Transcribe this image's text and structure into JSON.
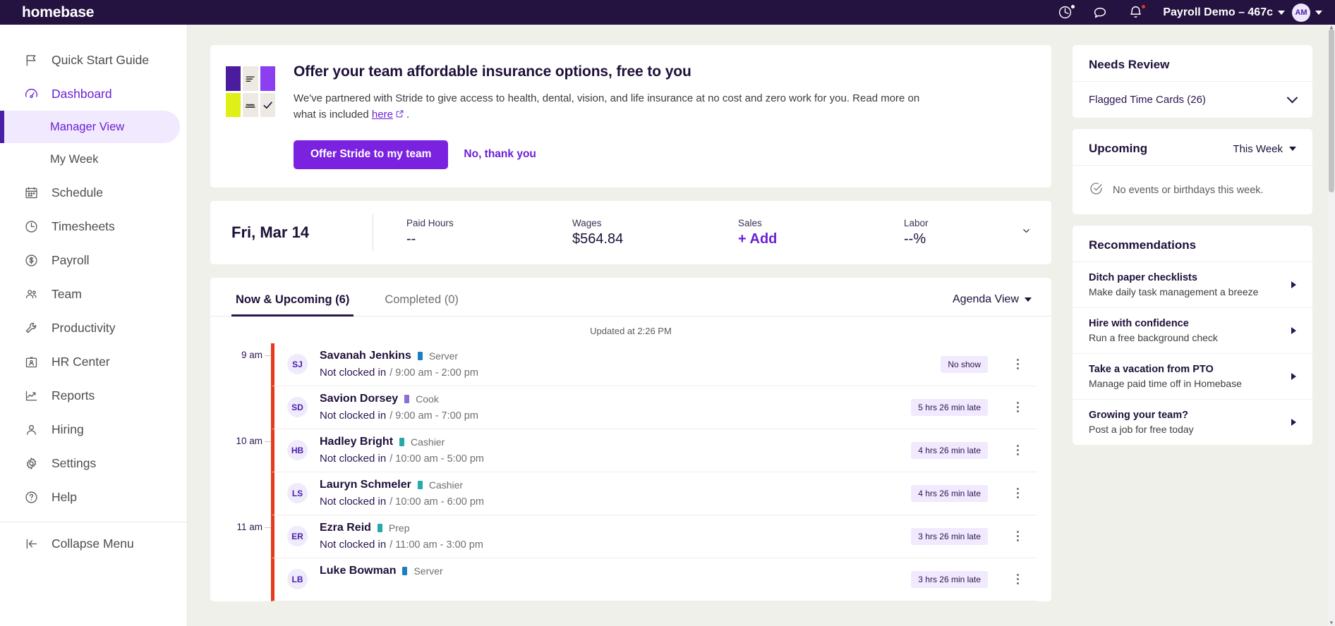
{
  "topbar": {
    "brand": "homebase",
    "account_label": "Payroll Demo – 467c",
    "avatar_initials": "AM",
    "icons": [
      {
        "name": "time-clock-icon",
        "badge": "white"
      },
      {
        "name": "chat-bubble-icon",
        "badge": "none"
      },
      {
        "name": "bell-icon",
        "badge": "red"
      }
    ]
  },
  "sidebar": {
    "items": [
      {
        "label": "Quick Start Guide",
        "icon": "flag-icon",
        "state": "default"
      },
      {
        "label": "Dashboard",
        "icon": "speedometer-icon",
        "state": "active"
      },
      {
        "label": "Schedule",
        "icon": "calendar-icon",
        "state": "default"
      },
      {
        "label": "Timesheets",
        "icon": "clock-icon",
        "state": "default"
      },
      {
        "label": "Payroll",
        "icon": "dollar-circle-icon",
        "state": "default"
      },
      {
        "label": "Team",
        "icon": "people-icon",
        "state": "default"
      },
      {
        "label": "Productivity",
        "icon": "wrench-icon",
        "state": "default"
      },
      {
        "label": "HR Center",
        "icon": "id-badge-icon",
        "state": "default"
      },
      {
        "label": "Reports",
        "icon": "chart-line-icon",
        "state": "default"
      },
      {
        "label": "Hiring",
        "icon": "person-icon",
        "state": "default"
      },
      {
        "label": "Settings",
        "icon": "gear-icon",
        "state": "default"
      },
      {
        "label": "Help",
        "icon": "question-circle-icon",
        "state": "default"
      }
    ],
    "sub_items": [
      {
        "label": "Manager View",
        "selected": true
      },
      {
        "label": "My Week",
        "selected": false
      }
    ],
    "collapse_label": "Collapse Menu"
  },
  "promo": {
    "title": "Offer your team affordable insurance options, free to you",
    "body_before": "We've partnered with Stride to give access to health, dental, vision, and life insurance at no cost and zero work for you. Read more on what is included ",
    "link_text": "here",
    "body_after": ".",
    "primary_button": "Offer Stride to my team",
    "secondary_button": "No, thank you"
  },
  "stats": {
    "date": "Fri, Mar 14",
    "items": [
      {
        "label": "Paid Hours",
        "value": "--",
        "accent": false
      },
      {
        "label": "Wages",
        "value": "$564.84",
        "accent": false
      },
      {
        "label": "Sales",
        "value": "+ Add",
        "accent": true
      },
      {
        "label": "Labor",
        "value": "--%",
        "accent": false
      }
    ]
  },
  "shifts": {
    "tabs": [
      {
        "label": "Now & Upcoming (6)",
        "active": true
      },
      {
        "label": "Completed (0)",
        "active": false
      }
    ],
    "view_selector": "Agenda View",
    "updated": "Updated at 2:26 PM",
    "rows": [
      {
        "time_label": "9 am",
        "initials": "SJ",
        "name": "Savanah Jenkins",
        "role": "Server",
        "role_color": "#1b7fc4",
        "status": "Not clocked in",
        "schedule": "/ 9:00 am - 2:00 pm",
        "badge": "No show"
      },
      {
        "time_label": "",
        "initials": "SD",
        "name": "Savion Dorsey",
        "role": "Cook",
        "role_color": "#8b6ed0",
        "status": "Not clocked in",
        "schedule": "/ 9:00 am - 7:00 pm",
        "badge": "5 hrs 26 min late"
      },
      {
        "time_label": "10 am",
        "initials": "HB",
        "name": "Hadley Bright",
        "role": "Cashier",
        "role_color": "#25a9a9",
        "status": "Not clocked in",
        "schedule": "/ 10:00 am - 5:00 pm",
        "badge": "4 hrs 26 min late"
      },
      {
        "time_label": "",
        "initials": "LS",
        "name": "Lauryn Schmeler",
        "role": "Cashier",
        "role_color": "#25a9a9",
        "status": "Not clocked in",
        "schedule": "/ 10:00 am - 6:00 pm",
        "badge": "4 hrs 26 min late"
      },
      {
        "time_label": "11 am",
        "initials": "ER",
        "name": "Ezra Reid",
        "role": "Prep",
        "role_color": "#25a9a9",
        "status": "Not clocked in",
        "schedule": "/ 11:00 am - 3:00 pm",
        "badge": "3 hrs 26 min late"
      },
      {
        "time_label": "",
        "initials": "LB",
        "name": "Luke Bowman",
        "role": "Server",
        "role_color": "#1b7fc4",
        "status": "",
        "schedule": "",
        "badge": "3 hrs 26 min late"
      }
    ]
  },
  "rail": {
    "needs_review": {
      "title": "Needs Review",
      "rows": [
        {
          "label": "Flagged Time Cards (26)"
        }
      ]
    },
    "upcoming": {
      "title": "Upcoming",
      "range": "This Week",
      "empty_text": "No events or birthdays this week."
    },
    "recommendations": {
      "title": "Recommendations",
      "items": [
        {
          "title": "Ditch paper checklists",
          "subtitle": "Make daily task management a breeze"
        },
        {
          "title": "Hire with confidence",
          "subtitle": "Run a free background check"
        },
        {
          "title": "Take a vacation from PTO",
          "subtitle": "Manage paid time off in Homebase"
        },
        {
          "title": "Growing your team?",
          "subtitle": "Post a job for free today"
        }
      ]
    }
  },
  "colors": {
    "brand_purple": "#7a22e0",
    "topbar_bg": "#241240",
    "accent_red": "#e8391c",
    "badge_bg": "#f1e9fe"
  }
}
